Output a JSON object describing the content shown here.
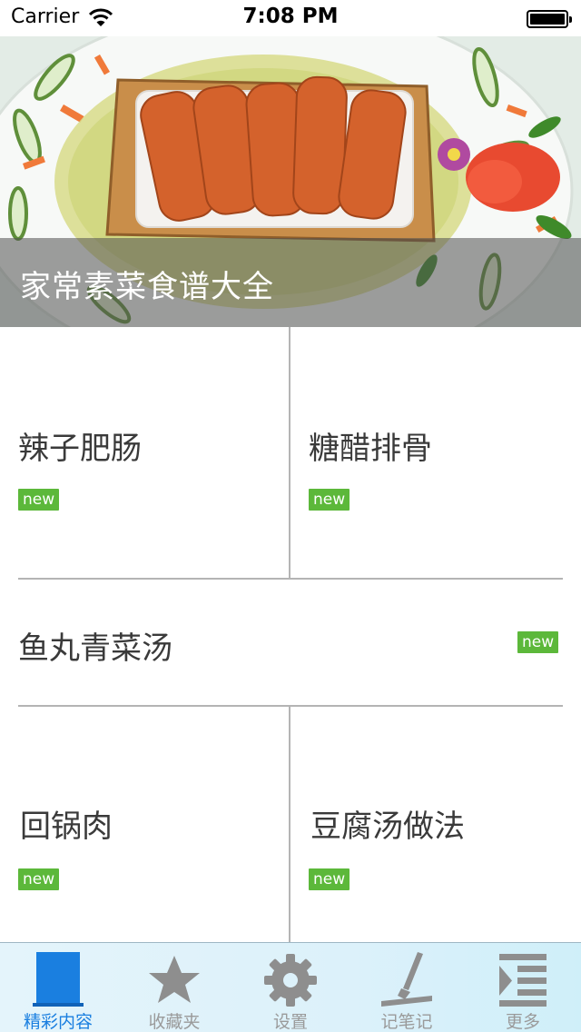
{
  "status_bar": {
    "carrier": "Carrier",
    "time": "7:08 PM"
  },
  "hero": {
    "title": "家常素菜食谱大全"
  },
  "recipes": [
    {
      "title": "辣子肥肠",
      "badge": "new"
    },
    {
      "title": "糖醋排骨",
      "badge": "new"
    },
    {
      "title": "鱼丸青菜汤",
      "badge": "new"
    },
    {
      "title": "回锅肉",
      "badge": "new"
    },
    {
      "title": "豆腐汤做法",
      "badge": "new"
    }
  ],
  "tabbar": {
    "selected_index": 0,
    "items": [
      {
        "label": "精彩内容",
        "icon": "featured-icon"
      },
      {
        "label": "收藏夹",
        "icon": "star-icon"
      },
      {
        "label": "设置",
        "icon": "gear-icon"
      },
      {
        "label": "记笔记",
        "icon": "pen-icon"
      },
      {
        "label": "更多",
        "icon": "more-list-icon"
      }
    ]
  },
  "colors": {
    "badge": "#5cb83a",
    "active_tab": "#1a7fe0",
    "inactive_tab": "#9a9a9a",
    "divider": "#b4b4b4"
  }
}
